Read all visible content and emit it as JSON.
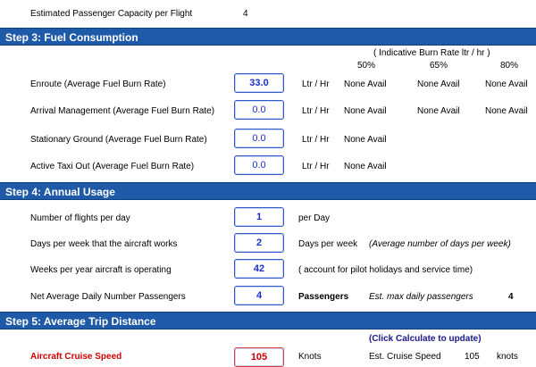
{
  "top": {
    "label": "Estimated Passenger Capacity per Flight",
    "value": "4"
  },
  "step3": {
    "title": "Step 3: Fuel Consumption",
    "burn_header": "( Indicative Burn Rate ltr / hr )",
    "pct_cols": [
      "50%",
      "65%",
      "80%"
    ],
    "rows": [
      {
        "label": "Enroute (Average Fuel Burn Rate)",
        "value": "33.0",
        "unit": "Ltr / Hr",
        "c50": "None Avail",
        "c65": "None Avail",
        "c80": "None Avail"
      },
      {
        "label": "Arrival Management (Average Fuel Burn Rate)",
        "value": "0.0",
        "unit": "Ltr / Hr",
        "c50": "None Avail",
        "c65": "None Avail",
        "c80": "None Avail"
      },
      {
        "label": "Stationary Ground (Average Fuel Burn Rate)",
        "value": "0.0",
        "unit": "Ltr / Hr",
        "c50": "None Avail"
      },
      {
        "label": "Active Taxi Out (Average Fuel Burn Rate)",
        "value": "0.0",
        "unit": "Ltr / Hr",
        "c50": "None Avail"
      }
    ]
  },
  "step4": {
    "title": "Step 4: Annual Usage",
    "rows": [
      {
        "label": "Number of flights per day",
        "value": "1",
        "unit": "per Day"
      },
      {
        "label": "Days per week that the aircraft works",
        "value": "2",
        "unit": "Days per week",
        "note": "(Average number of days per week)"
      },
      {
        "label": "Weeks per year aircraft is operating",
        "value": "42",
        "unit": "( account for pilot holidays and service time)"
      },
      {
        "label": "Net Average Daily Number Passengers",
        "value": "4",
        "unit": "Passengers",
        "note": "Est. max daily passengers",
        "extra": "4"
      }
    ]
  },
  "step5": {
    "title": "Step 5: Average Trip Distance",
    "calc_note": "(Click Calculate to update)",
    "cruise": {
      "label": "Aircraft Cruise Speed",
      "value": "105",
      "unit": "Knots",
      "est_label": "Est. Cruise Speed",
      "est_value": "105",
      "est_unit": "knots"
    }
  }
}
